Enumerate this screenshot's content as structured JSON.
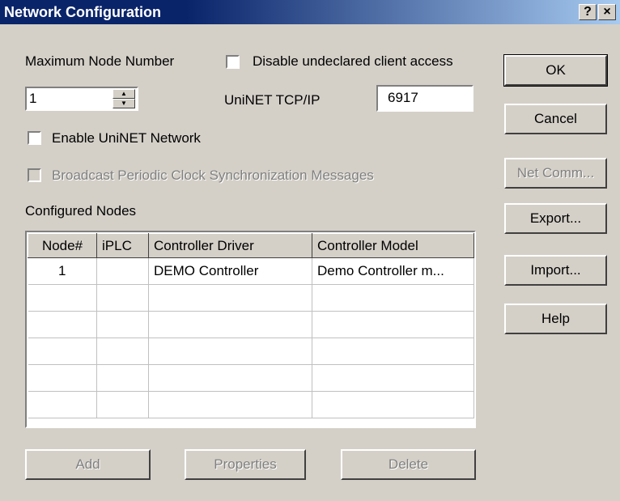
{
  "window": {
    "title": "Network Configuration",
    "help_glyph": "?",
    "close_glyph": "×"
  },
  "labels": {
    "max_node": "Maximum Node Number",
    "disable_access": "Disable undeclared client access",
    "uninet_tcp": "UniNET TCP/IP",
    "enable_uninet": "Enable UniNET Network",
    "broadcast": "Broadcast Periodic Clock Synchronization Messages",
    "configured_nodes": "Configured Nodes"
  },
  "inputs": {
    "max_node_value": "1",
    "tcp_port_value": "6917"
  },
  "table": {
    "headers": [
      "Node#",
      "iPLC",
      "Controller Driver",
      "Controller Model"
    ],
    "rows": [
      [
        "1",
        "",
        "DEMO Controller",
        "Demo Controller m..."
      ],
      [
        "",
        "",
        "",
        ""
      ],
      [
        "",
        "",
        "",
        ""
      ],
      [
        "",
        "",
        "",
        ""
      ],
      [
        "",
        "",
        "",
        ""
      ],
      [
        "",
        "",
        "",
        ""
      ]
    ]
  },
  "buttons": {
    "ok": "OK",
    "cancel": "Cancel",
    "net_comm": "Net Comm...",
    "export": "Export...",
    "import": "Import...",
    "help": "Help",
    "add": "Add",
    "properties": "Properties",
    "delete": "Delete"
  },
  "icons": {
    "spin_up": "▲",
    "spin_down": "▼"
  }
}
